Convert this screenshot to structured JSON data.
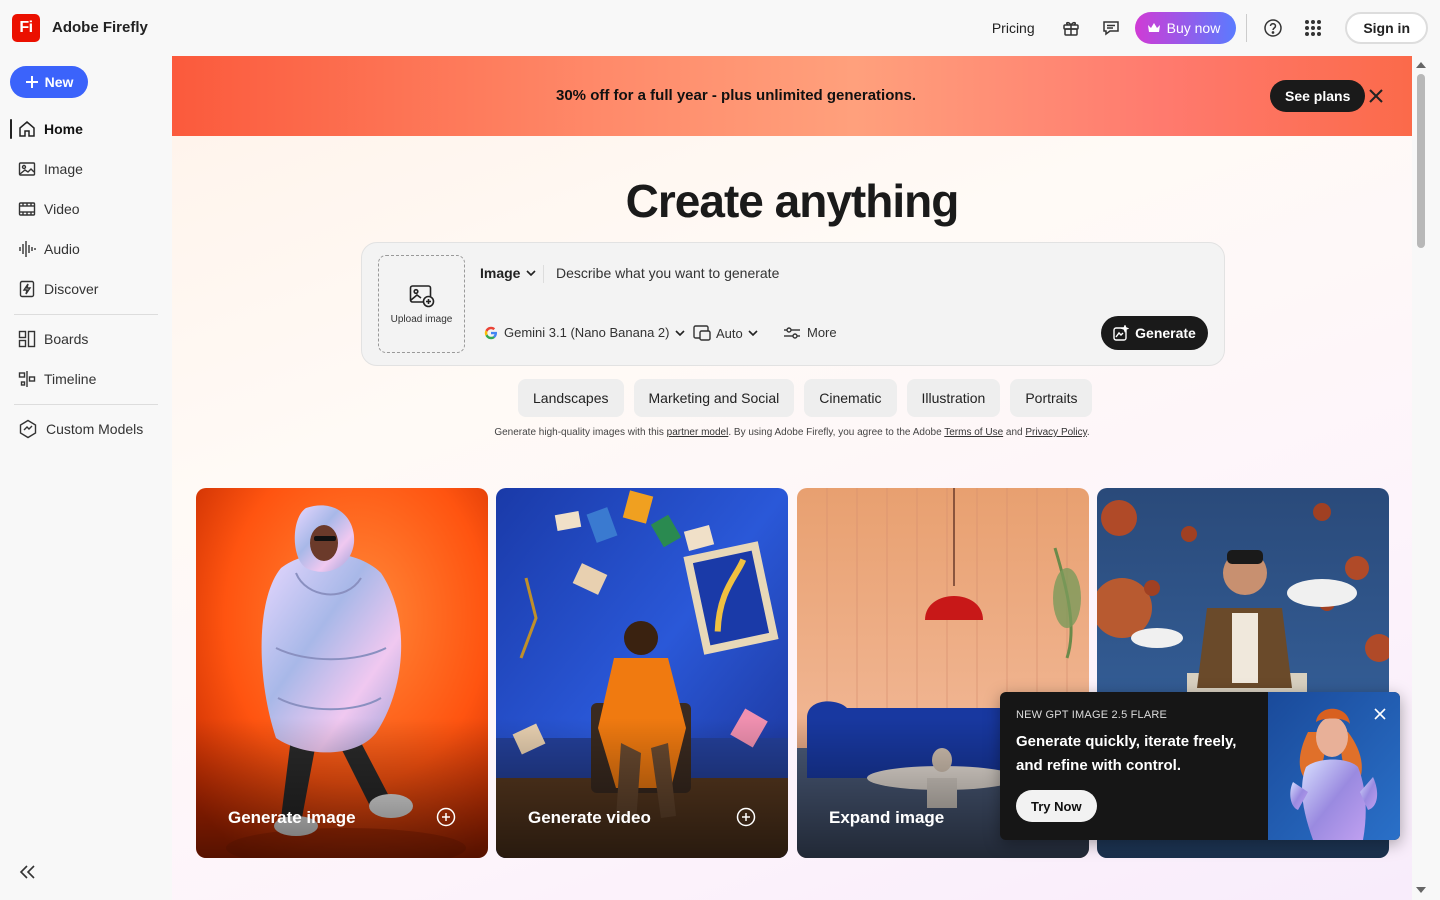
{
  "app": {
    "logo_text": "Fi",
    "title": "Adobe Firefly"
  },
  "topnav": {
    "pricing": "Pricing",
    "buy_now": "Buy now",
    "sign_in": "Sign in",
    "icons": [
      "gift-icon",
      "chat-icon",
      "crown-icon",
      "help-icon",
      "apps-grid-icon"
    ]
  },
  "sidebar": {
    "new_label": "New",
    "items": [
      {
        "label": "Home",
        "icon": "home-icon",
        "active": true
      },
      {
        "label": "Image",
        "icon": "image-icon"
      },
      {
        "label": "Video",
        "icon": "video-icon"
      },
      {
        "label": "Audio",
        "icon": "audio-icon"
      },
      {
        "label": "Discover",
        "icon": "discover-icon"
      },
      {
        "label": "Boards",
        "icon": "boards-icon"
      },
      {
        "label": "Timeline",
        "icon": "timeline-icon"
      },
      {
        "label": "Custom Models",
        "icon": "custom-models-icon"
      }
    ]
  },
  "promo": {
    "text": "30% off for a full year  - plus unlimited generations.",
    "cta": "See plans"
  },
  "hero": {
    "title": "Create anything"
  },
  "prompt": {
    "upload_label": "Upload image",
    "mode": "Image",
    "placeholder": "Describe what you want to generate",
    "model": "Gemini 3.1 (Nano Banana 2)",
    "ratio": "Auto",
    "more": "More",
    "generate": "Generate"
  },
  "chips": [
    "Landscapes",
    "Marketing and Social",
    "Cinematic",
    "Illustration",
    "Portraits"
  ],
  "disclaimer": {
    "part1": "Generate high-quality images with this ",
    "link1": "partner model",
    "part2": ". By using Adobe Firefly, you agree to the Adobe ",
    "link2": "Terms of Use",
    "part3": " and ",
    "link3": "Privacy Policy",
    "part4": "."
  },
  "cards": [
    {
      "label": "Generate image"
    },
    {
      "label": "Generate video"
    },
    {
      "label": "Expand image"
    },
    {
      "label": ""
    }
  ],
  "toast": {
    "eyebrow": "NEW GPT IMAGE 2.5 FLARE",
    "title": "Generate quickly, iterate freely, and refine with control.",
    "cta": "Try Now"
  },
  "colors": {
    "accent_blue": "#3b63fb",
    "brand_red": "#eb1000",
    "dark": "#1a1a1a"
  }
}
